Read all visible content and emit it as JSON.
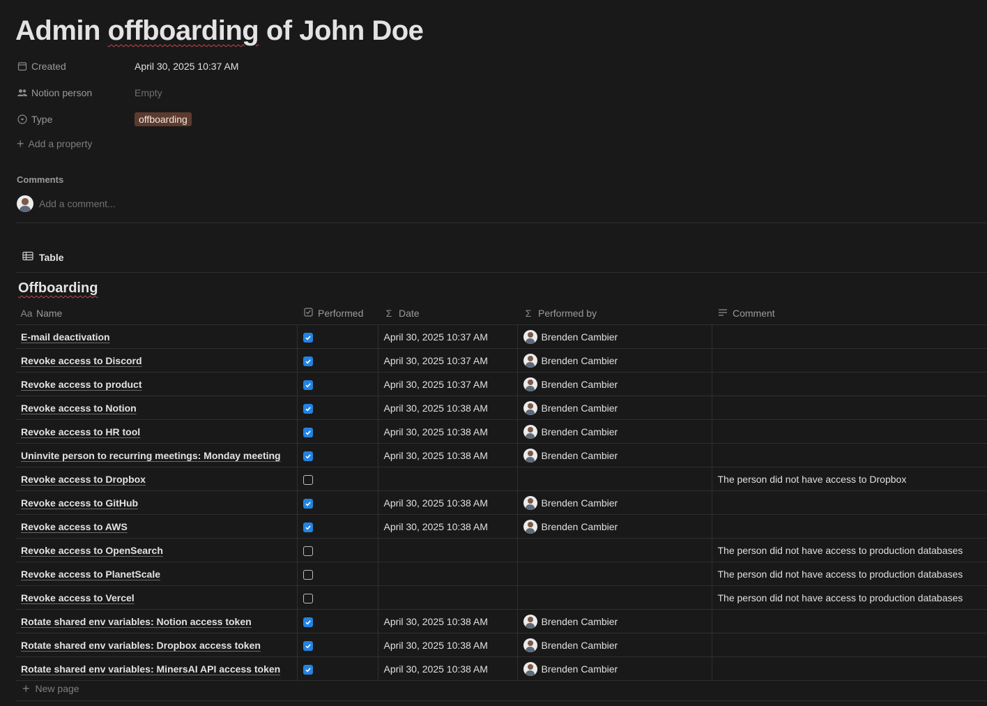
{
  "page": {
    "title_pre": "Admin ",
    "title_squiggle": "offboarding",
    "title_post": " of John Doe"
  },
  "properties": [
    {
      "icon": "calendar-icon",
      "name": "Created",
      "value": "April 30, 2025 10:37 AM"
    },
    {
      "icon": "people-icon",
      "name": "Notion person",
      "value": "Empty"
    },
    {
      "icon": "select-icon",
      "name": "Type",
      "value": "offboarding"
    }
  ],
  "add_property_label": "Add a property",
  "comments": {
    "heading": "Comments",
    "placeholder": "Add a comment..."
  },
  "view": {
    "tab_label": "Table",
    "db_title": "Offboarding"
  },
  "columns": [
    {
      "icon": "Aa",
      "label": "Name"
    },
    {
      "icon": "checkbox-icon",
      "label": "Performed"
    },
    {
      "icon": "Σ",
      "label": "Date"
    },
    {
      "icon": "Σ",
      "label": "Performed by"
    },
    {
      "icon": "text-icon",
      "label": "Comment"
    }
  ],
  "rows": [
    {
      "name": "E-mail deactivation",
      "performed": true,
      "date": "April 30, 2025 10:37 AM",
      "by": "Brenden Cambier",
      "comment": ""
    },
    {
      "name": "Revoke access to Discord",
      "performed": true,
      "date": "April 30, 2025 10:37 AM",
      "by": "Brenden Cambier",
      "comment": ""
    },
    {
      "name": "Revoke access to product",
      "performed": true,
      "date": "April 30, 2025 10:37 AM",
      "by": "Brenden Cambier",
      "comment": ""
    },
    {
      "name": "Revoke access to Notion",
      "performed": true,
      "date": "April 30, 2025 10:38 AM",
      "by": "Brenden Cambier",
      "comment": ""
    },
    {
      "name": "Revoke access to HR tool",
      "performed": true,
      "date": "April 30, 2025 10:38 AM",
      "by": "Brenden Cambier",
      "comment": ""
    },
    {
      "name": "Uninvite person to recurring meetings: Monday meeting",
      "performed": true,
      "date": "April 30, 2025 10:38 AM",
      "by": "Brenden Cambier",
      "comment": ""
    },
    {
      "name": "Revoke access to Dropbox",
      "performed": false,
      "date": "",
      "by": "",
      "comment": "The person did not have access to Dropbox"
    },
    {
      "name": "Revoke access to GitHub",
      "performed": true,
      "date": "April 30, 2025 10:38 AM",
      "by": "Brenden Cambier",
      "comment": ""
    },
    {
      "name": "Revoke access to AWS",
      "performed": true,
      "date": "April 30, 2025 10:38 AM",
      "by": "Brenden Cambier",
      "comment": ""
    },
    {
      "name": "Revoke access to OpenSearch",
      "performed": false,
      "date": "",
      "by": "",
      "comment": "The person did not have access to production databases"
    },
    {
      "name": "Revoke access to PlanetScale",
      "performed": false,
      "date": "",
      "by": "",
      "comment": "The person did not have access to production databases"
    },
    {
      "name": "Revoke access to Vercel",
      "performed": false,
      "date": "",
      "by": "",
      "comment": "The person did not have access to production databases"
    },
    {
      "name": "Rotate shared env variables: Notion access token",
      "performed": true,
      "date": "April 30, 2025 10:38 AM",
      "by": "Brenden Cambier",
      "comment": ""
    },
    {
      "name": "Rotate shared env variables: Dropbox access token",
      "performed": true,
      "date": "April 30, 2025 10:38 AM",
      "by": "Brenden Cambier",
      "comment": ""
    },
    {
      "name": "Rotate shared env variables: MinersAI API access token",
      "performed": true,
      "date": "April 30, 2025 10:38 AM",
      "by": "Brenden Cambier",
      "comment": ""
    }
  ],
  "new_page_label": "New page",
  "colors": {
    "background": "#191919",
    "checkbox_on": "#2383e2",
    "tag": "#5c3b2f"
  }
}
